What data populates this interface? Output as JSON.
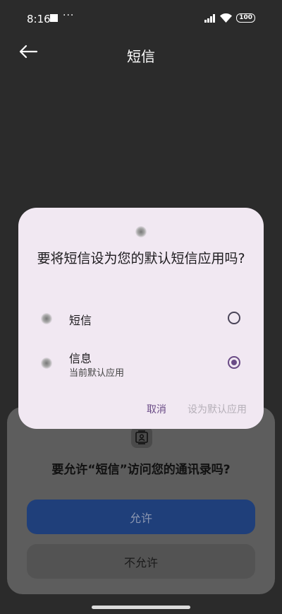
{
  "status_bar": {
    "time": "8:16",
    "dots": "···",
    "battery": "100"
  },
  "app_bar": {
    "title": "短信"
  },
  "permission_sheet": {
    "question": "要允许“短信”访问您的通讯录吗?",
    "allow_label": "允许",
    "deny_label": "不允许"
  },
  "dialog": {
    "title": "要将短信设为您的默认短信应用吗?",
    "options": [
      {
        "label": "短信",
        "subtitle": "",
        "selected": false
      },
      {
        "label": "信息",
        "subtitle": "当前默认应用",
        "selected": true
      }
    ],
    "cancel_label": "取消",
    "set_default_label": "设为默认应用"
  },
  "colors": {
    "accent": "#6a4b86",
    "dialog_bg": "#f1e8f2",
    "allow_button": "#1f3f7a"
  }
}
